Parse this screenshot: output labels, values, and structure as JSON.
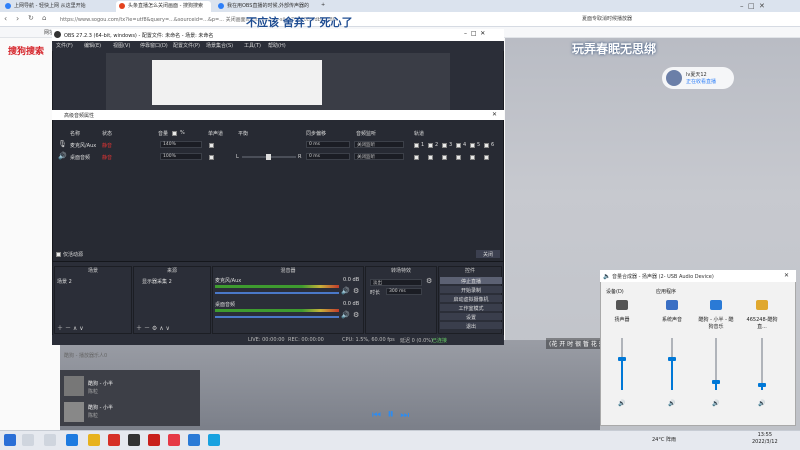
{
  "browser": {
    "tabs": [
      {
        "label": "上网导航 - 轻快上网 从这里开始",
        "active": false
      },
      {
        "label": "头条直播怎么关闭画面 - 搜狗搜索",
        "active": true
      },
      {
        "label": "我在用OBS直播的时候,外部传声器的",
        "active": false
      },
      {
        "label": "+",
        "active": false
      }
    ],
    "url": "https://www.sogou.com/tx?ie=utf8&query=...&sourceid=...&p=... 关闭画面&hdq=sogou-site-706608cfdbcc18fe",
    "search_logo": "搜狗搜索",
    "right_promo": "夏面专取消时候播放器",
    "bookmark": "网址"
  },
  "banner_caption": "不应该 舍弃了 死心了",
  "overlay_text": "玩弄春眠无思绑",
  "username_card": {
    "name": "lv夏天12",
    "sub": "正在收看直播"
  },
  "obs": {
    "title": "OBS 27.2.3 (64-bit, windows) - 配置文件: 未命名 - 场景: 未命名",
    "menu": [
      "文件(F)",
      "编辑(E)",
      "视图(V)",
      "停靠窗口(D)",
      "配置文件(P)",
      "场景集合(S)",
      "工具(T)",
      "帮助(H)"
    ],
    "status": {
      "live": "LIVE: 00:00:00",
      "rec": "REC: 00:00:00",
      "cpu": "CPU: 1.5%, 60.00 fps",
      "drop": "延迟 0 (0.0%)",
      "encode": "已连接"
    }
  },
  "mixer": {
    "title": "高级音频属性",
    "headers": [
      "名称",
      "状态",
      "音量",
      "单声道",
      "平衡",
      "同步偏移",
      "音频监听",
      "轨道"
    ],
    "rows": [
      {
        "name": "麦克风/Aux",
        "status": "静音",
        "volume": "140%",
        "offset": "0 ms",
        "monitor": "关闭监听",
        "icon": "mic-icon"
      },
      {
        "name": "桌面音频",
        "status": "静音",
        "volume": "100%",
        "offset": "0 ms",
        "monitor": "关闭监听",
        "icon": "speaker-icon"
      }
    ],
    "percent_flag": "%",
    "tracks": [
      "1",
      "2",
      "3",
      "4",
      "5",
      "6"
    ],
    "active_only": "仅活动源",
    "close": "关闭",
    "balance_l": "L",
    "balance_r": "R"
  },
  "docks": {
    "scenes": {
      "title": "场景",
      "items": [
        "场景 2"
      ]
    },
    "sources": {
      "title": "来源",
      "items": [
        "显示器采集 2"
      ]
    },
    "mixer": {
      "title": "混音器",
      "channels": [
        {
          "name": "麦克风/Aux",
          "db": "0.0 dB"
        },
        {
          "name": "桌面音频",
          "db": "0.0 dB"
        }
      ]
    },
    "transitions": {
      "title": "转场特效",
      "type": "淡出",
      "duration_label": "时长",
      "duration": "300 ms"
    },
    "controls": {
      "title": "控件",
      "buttons": [
        "停止直播",
        "开始录制",
        "启动虚拟摄像机",
        "工作室模式",
        "设置",
        "退出"
      ]
    }
  },
  "volume_mixer": {
    "title": "音量合成器 - 扬声器 (2- USB Audio Device)",
    "device_label": "设备(D)",
    "apps_label": "应用程序",
    "channels": [
      {
        "name": "扬声器",
        "level": 0.6,
        "color": "#555555"
      },
      {
        "name": "系统声音",
        "level": 0.6,
        "color": "#3a6fc4"
      },
      {
        "name": "酷狗 - 小半 - 酷狗音乐",
        "level": 0.15,
        "color": "#2a7ad6"
      },
      {
        "name": "465248-酷狗直...",
        "level": 0.1,
        "color": "#e0a82e"
      }
    ]
  },
  "player": {
    "tracks": [
      {
        "title": "酷狗 - 播放器乐人0",
        "artist": ""
      },
      {
        "title": "酷狗 - 小半",
        "artist": "陈粒"
      },
      {
        "title": "酷狗 - 小半",
        "artist": "陈粒"
      }
    ],
    "lyric": "(花 开 时 很 暂 花 落 时 很"
  },
  "taskbar": {
    "weather": "24°C 阵雨",
    "time": "13:55",
    "date": "2022/3/12"
  }
}
